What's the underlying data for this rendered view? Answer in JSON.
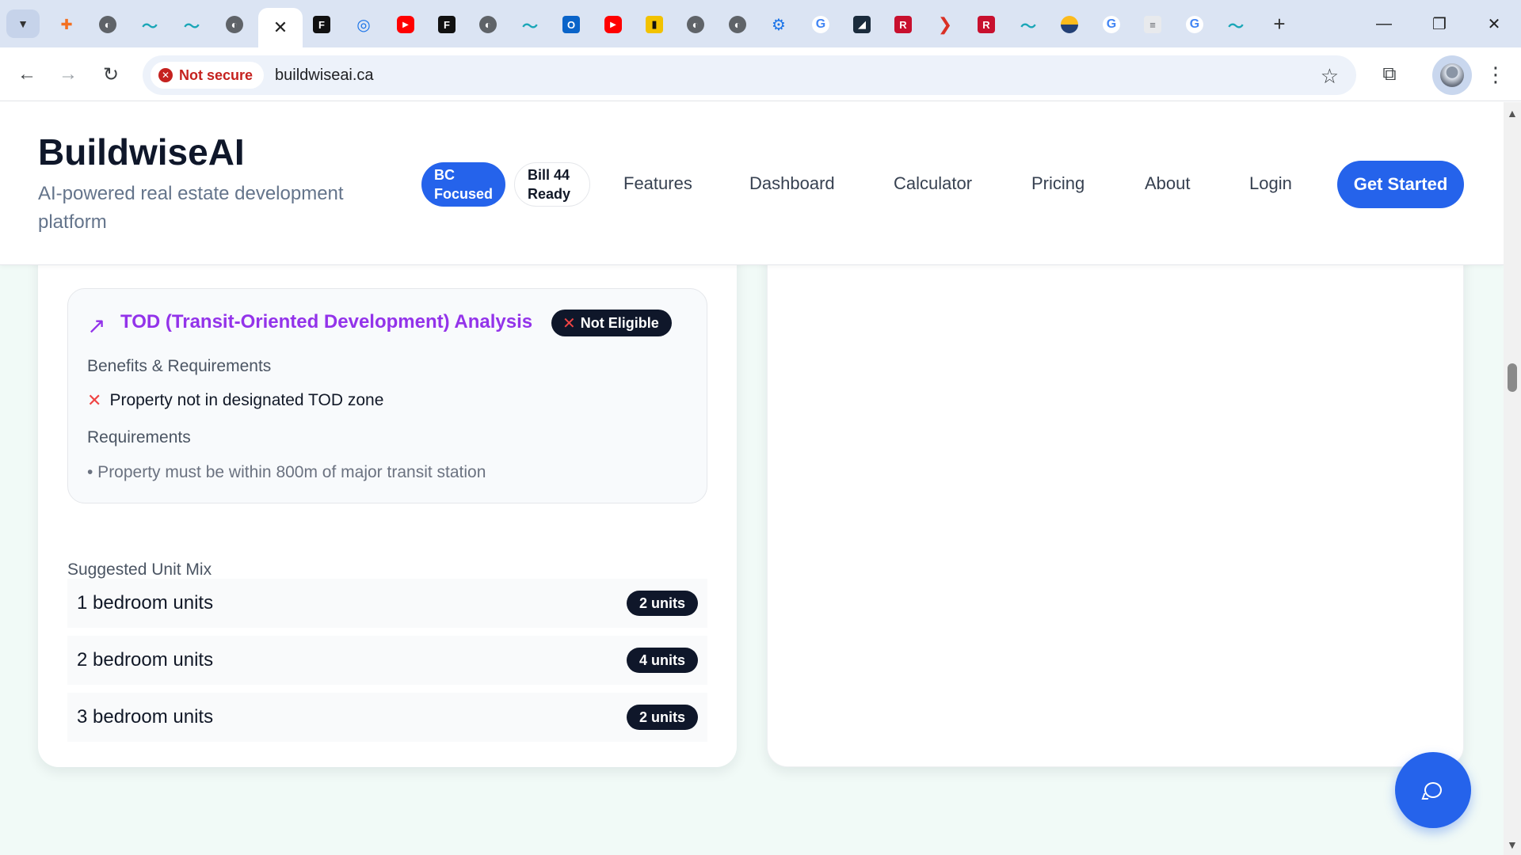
{
  "browser": {
    "address_bar": {
      "security_label": "Not secure",
      "url": "buildwiseai.ca"
    },
    "tabs": [
      {
        "icon": "orange-tool-icon"
      },
      {
        "icon": "globe-icon"
      },
      {
        "icon": "wave-logo-icon"
      },
      {
        "icon": "wave-logo-icon"
      },
      {
        "icon": "globe-icon"
      },
      {
        "icon": "close-icon",
        "active": true
      },
      {
        "icon": "framer-icon"
      },
      {
        "icon": "swirl-icon"
      },
      {
        "icon": "youtube-icon"
      },
      {
        "icon": "framer-icon"
      },
      {
        "icon": "globe-icon"
      },
      {
        "icon": "wave-logo-icon"
      },
      {
        "icon": "outlook-icon"
      },
      {
        "icon": "youtube-icon"
      },
      {
        "icon": "yellow-app-icon"
      },
      {
        "icon": "globe-icon"
      },
      {
        "icon": "globe-icon"
      },
      {
        "icon": "gear-icon"
      },
      {
        "icon": "google-icon"
      },
      {
        "icon": "chart-icon"
      },
      {
        "icon": "realtor-r-icon"
      },
      {
        "icon": "red-chevron-icon"
      },
      {
        "icon": "realtor-r-icon"
      },
      {
        "icon": "wave-logo-icon"
      },
      {
        "icon": "bc-gov-icon"
      },
      {
        "icon": "google-icon"
      },
      {
        "icon": "document-icon"
      },
      {
        "icon": "google-icon"
      },
      {
        "icon": "wave-logo-icon"
      }
    ]
  },
  "site": {
    "brand": "BuildwiseAI",
    "tagline": "AI-powered real estate development platform",
    "badges": {
      "bc": [
        "BC",
        "Focused"
      ],
      "bill": [
        "Bill 44",
        "Ready"
      ]
    },
    "nav": [
      "Features",
      "Dashboard",
      "Calculator",
      "Pricing",
      "About",
      "Login"
    ],
    "cta": "Get Started"
  },
  "tod": {
    "title": "TOD (Transit-Oriented Development) Analysis",
    "status_badge": "Not Eligible",
    "benefits_heading": "Benefits & Requirements",
    "benefit_item": "Property not in designated TOD zone",
    "requirements_heading": "Requirements",
    "requirement_item": "• Property must be within 800m of major transit station"
  },
  "unit_mix": {
    "label": "Suggested Unit Mix",
    "rows": [
      {
        "name": "1 bedroom units",
        "count": "2 units"
      },
      {
        "name": "2 bedroom units",
        "count": "4 units"
      },
      {
        "name": "3 bedroom units",
        "count": "2 units"
      }
    ]
  },
  "colors": {
    "primary": "#2563eb",
    "tod_purple": "#9333ea",
    "badge_dark": "#0f172a",
    "error_red": "#ef4444",
    "page_bg": "#f1faf7"
  }
}
